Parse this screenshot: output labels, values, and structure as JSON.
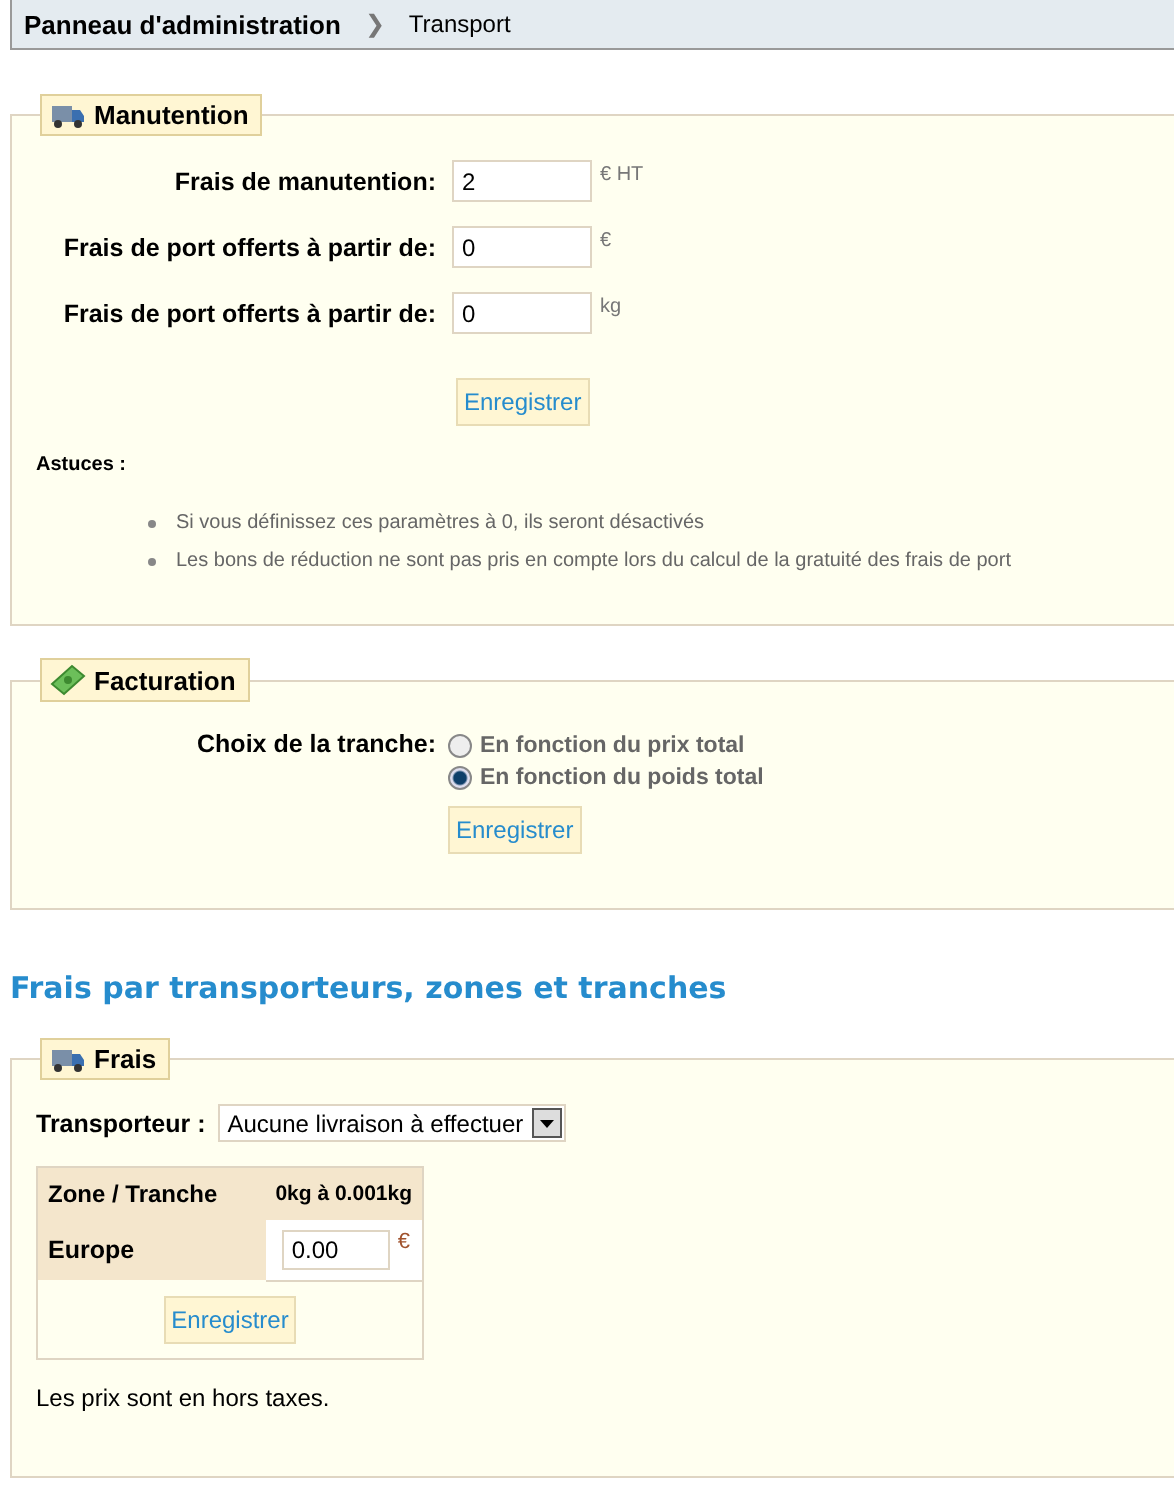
{
  "breadcrumb": {
    "parent": "Panneau d'administration",
    "separator": "❯",
    "current": "Transport"
  },
  "handling": {
    "legend": "Manutention",
    "fields": [
      {
        "label": "Frais de manutention:",
        "value": "2",
        "unit": "€ HT"
      },
      {
        "label": "Frais de port offerts à partir de:",
        "value": "0",
        "unit": "€"
      },
      {
        "label": "Frais de port offerts à partir de:",
        "value": "0",
        "unit": "kg"
      }
    ],
    "button": "Enregistrer",
    "tips_title": "Astuces :",
    "tips": [
      "Si vous définissez ces paramètres à 0, ils seront désactivés",
      "Les bons de réduction ne sont pas pris en compte lors du calcul de la gratuité des frais de port"
    ]
  },
  "billing": {
    "legend": "Facturation",
    "label": "Choix de la tranche:",
    "options": [
      {
        "label": "En fonction du prix total",
        "selected": false
      },
      {
        "label": "En fonction du poids total",
        "selected": true
      }
    ],
    "button": "Enregistrer"
  },
  "fees_heading": "Frais par transporteurs, zones et tranches",
  "fees": {
    "legend": "Frais",
    "carrier_label": "Transporteur :",
    "carrier_value": "Aucune livraison à effectuer",
    "table": {
      "corner": "Zone / Tranche",
      "columns": [
        "0kg à 0.001kg"
      ],
      "rows": [
        {
          "zone": "Europe",
          "value": "0.00",
          "unit": "€"
        }
      ]
    },
    "button": "Enregistrer",
    "note": "Les prix sont en hors taxes."
  }
}
